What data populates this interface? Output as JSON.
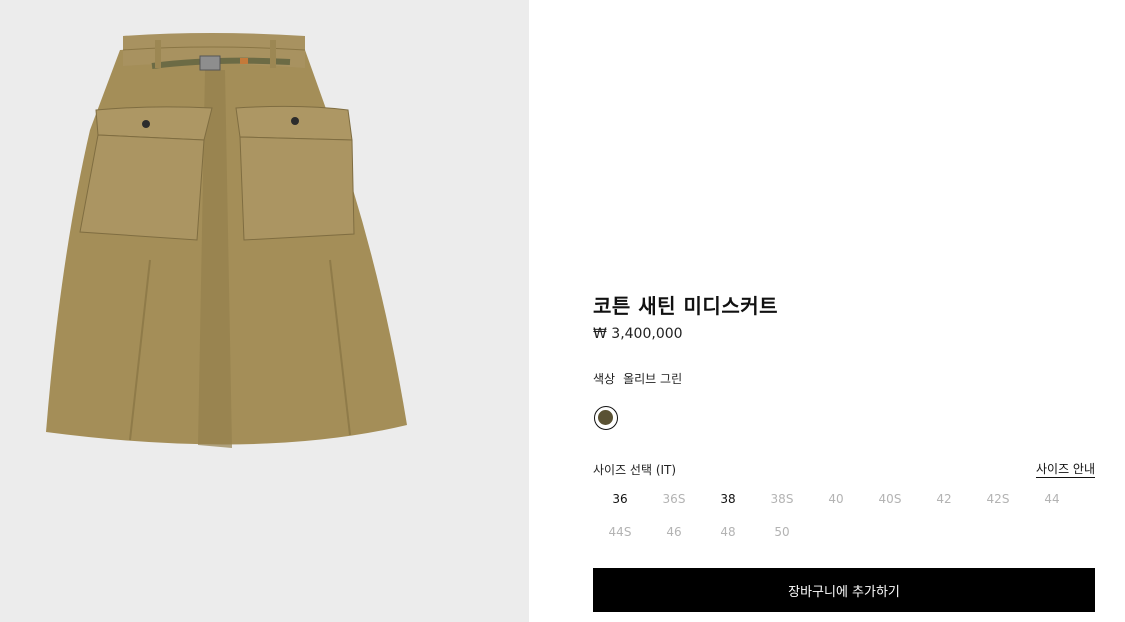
{
  "product": {
    "title": "코튼 새틴 미디스커트",
    "price": "₩ 3,400,000",
    "image_alt": "skirt-product-image"
  },
  "color": {
    "label": "색상",
    "value": "올리브 그린",
    "swatch_hex": "#5a5233"
  },
  "size": {
    "label": "사이즈 선택 (IT)",
    "guide_label": "사이즈 안내",
    "options": [
      {
        "label": "36",
        "available": true
      },
      {
        "label": "36S",
        "available": false
      },
      {
        "label": "38",
        "available": true
      },
      {
        "label": "38S",
        "available": false
      },
      {
        "label": "40",
        "available": false
      },
      {
        "label": "40S",
        "available": false
      },
      {
        "label": "42",
        "available": false
      },
      {
        "label": "42S",
        "available": false
      },
      {
        "label": "44",
        "available": false
      },
      {
        "label": "44S",
        "available": false
      },
      {
        "label": "46",
        "available": false
      },
      {
        "label": "48",
        "available": false
      },
      {
        "label": "50",
        "available": false
      }
    ]
  },
  "cart": {
    "button_label": "장바구니에 추가하기"
  },
  "colors": {
    "image_bg": "#ececec",
    "skirt": "#a48e58",
    "button_bg": "#000000",
    "unavailable_text": "#b3b3b3"
  }
}
